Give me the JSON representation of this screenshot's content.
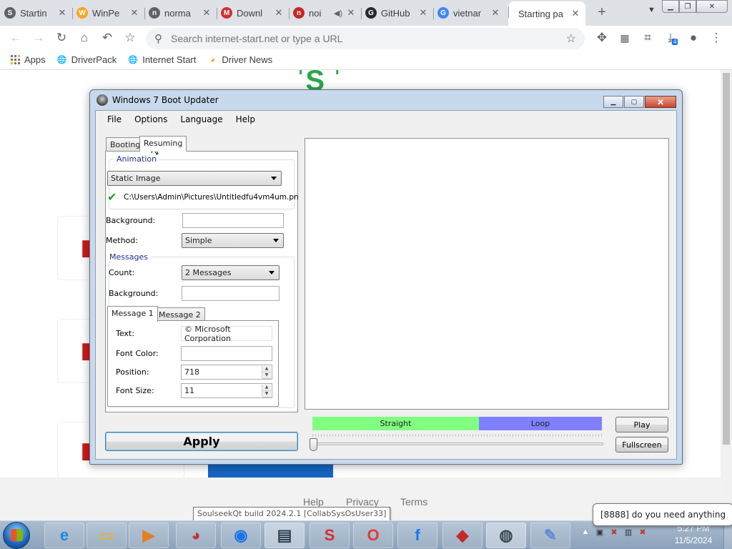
{
  "browser": {
    "tabs": [
      {
        "title": "Startin",
        "color": "#5f6368",
        "icon": "S"
      },
      {
        "title": "WinPe",
        "color": "#f5a623",
        "icon": "W"
      },
      {
        "title": "norma",
        "color": "#5f6368",
        "icon": "n"
      },
      {
        "title": "Downl",
        "color": "#d32f2f",
        "icon": "M"
      },
      {
        "title": "noi",
        "color": "#c62828",
        "icon": "n"
      },
      {
        "title": "GitHub",
        "color": "#24292e",
        "icon": "G"
      },
      {
        "title": "vietnar",
        "color": "#4285f4",
        "icon": "G"
      },
      {
        "title": "Starting pa",
        "color": "#5f6368",
        "icon": "S"
      }
    ],
    "omnibox_placeholder": "Search internet-start.net or type a URL",
    "downloads_badge": "4",
    "bookmarks": [
      {
        "label": "Apps",
        "icon": "apps-grid-icon"
      },
      {
        "label": "DriverPack",
        "icon": "globe-icon"
      },
      {
        "label": "Internet Start",
        "icon": "globe-icon"
      },
      {
        "label": "Driver News",
        "icon": "news-icon"
      }
    ]
  },
  "page": {
    "footer_links": [
      "Help",
      "Privacy",
      "Terms"
    ]
  },
  "dialog": {
    "title": "Windows 7 Boot Updater",
    "menu": [
      "File",
      "Options",
      "Language",
      "Help"
    ],
    "tabs": [
      "Booting",
      "Resuming"
    ],
    "selected_tab": "Resuming",
    "animation": {
      "group_label": "Animation",
      "type_value": "Static Image",
      "file_path": "C:\\Users\\Admin\\Pictures\\Untitledfu4vm4um.pn"
    },
    "background_label": "Background:",
    "method_label": "Method:",
    "method_value": "Simple",
    "messages": {
      "group_label": "Messages",
      "count_label": "Count:",
      "count_value": "2 Messages",
      "background_label": "Background:",
      "tabs": [
        "Message 1",
        "Message 2"
      ],
      "text_label": "Text:",
      "text_value": "© Microsoft Corporation",
      "font_color_label": "Font Color:",
      "position_label": "Position:",
      "position_value": "718",
      "font_size_label": "Font Size:",
      "font_size_value": "11"
    },
    "straight_label": "Straight",
    "loop_label": "Loop",
    "play_label": "Play",
    "fullscreen_label": "Fullscreen",
    "apply_label": "Apply"
  },
  "taskbar": {
    "tooltip": "SoulseekQt build 2024.2.1 [CollabSysOsUser33]",
    "balloon": "[8888] do you need anything",
    "time": "5:27 PM",
    "date": "11/5/2024"
  }
}
